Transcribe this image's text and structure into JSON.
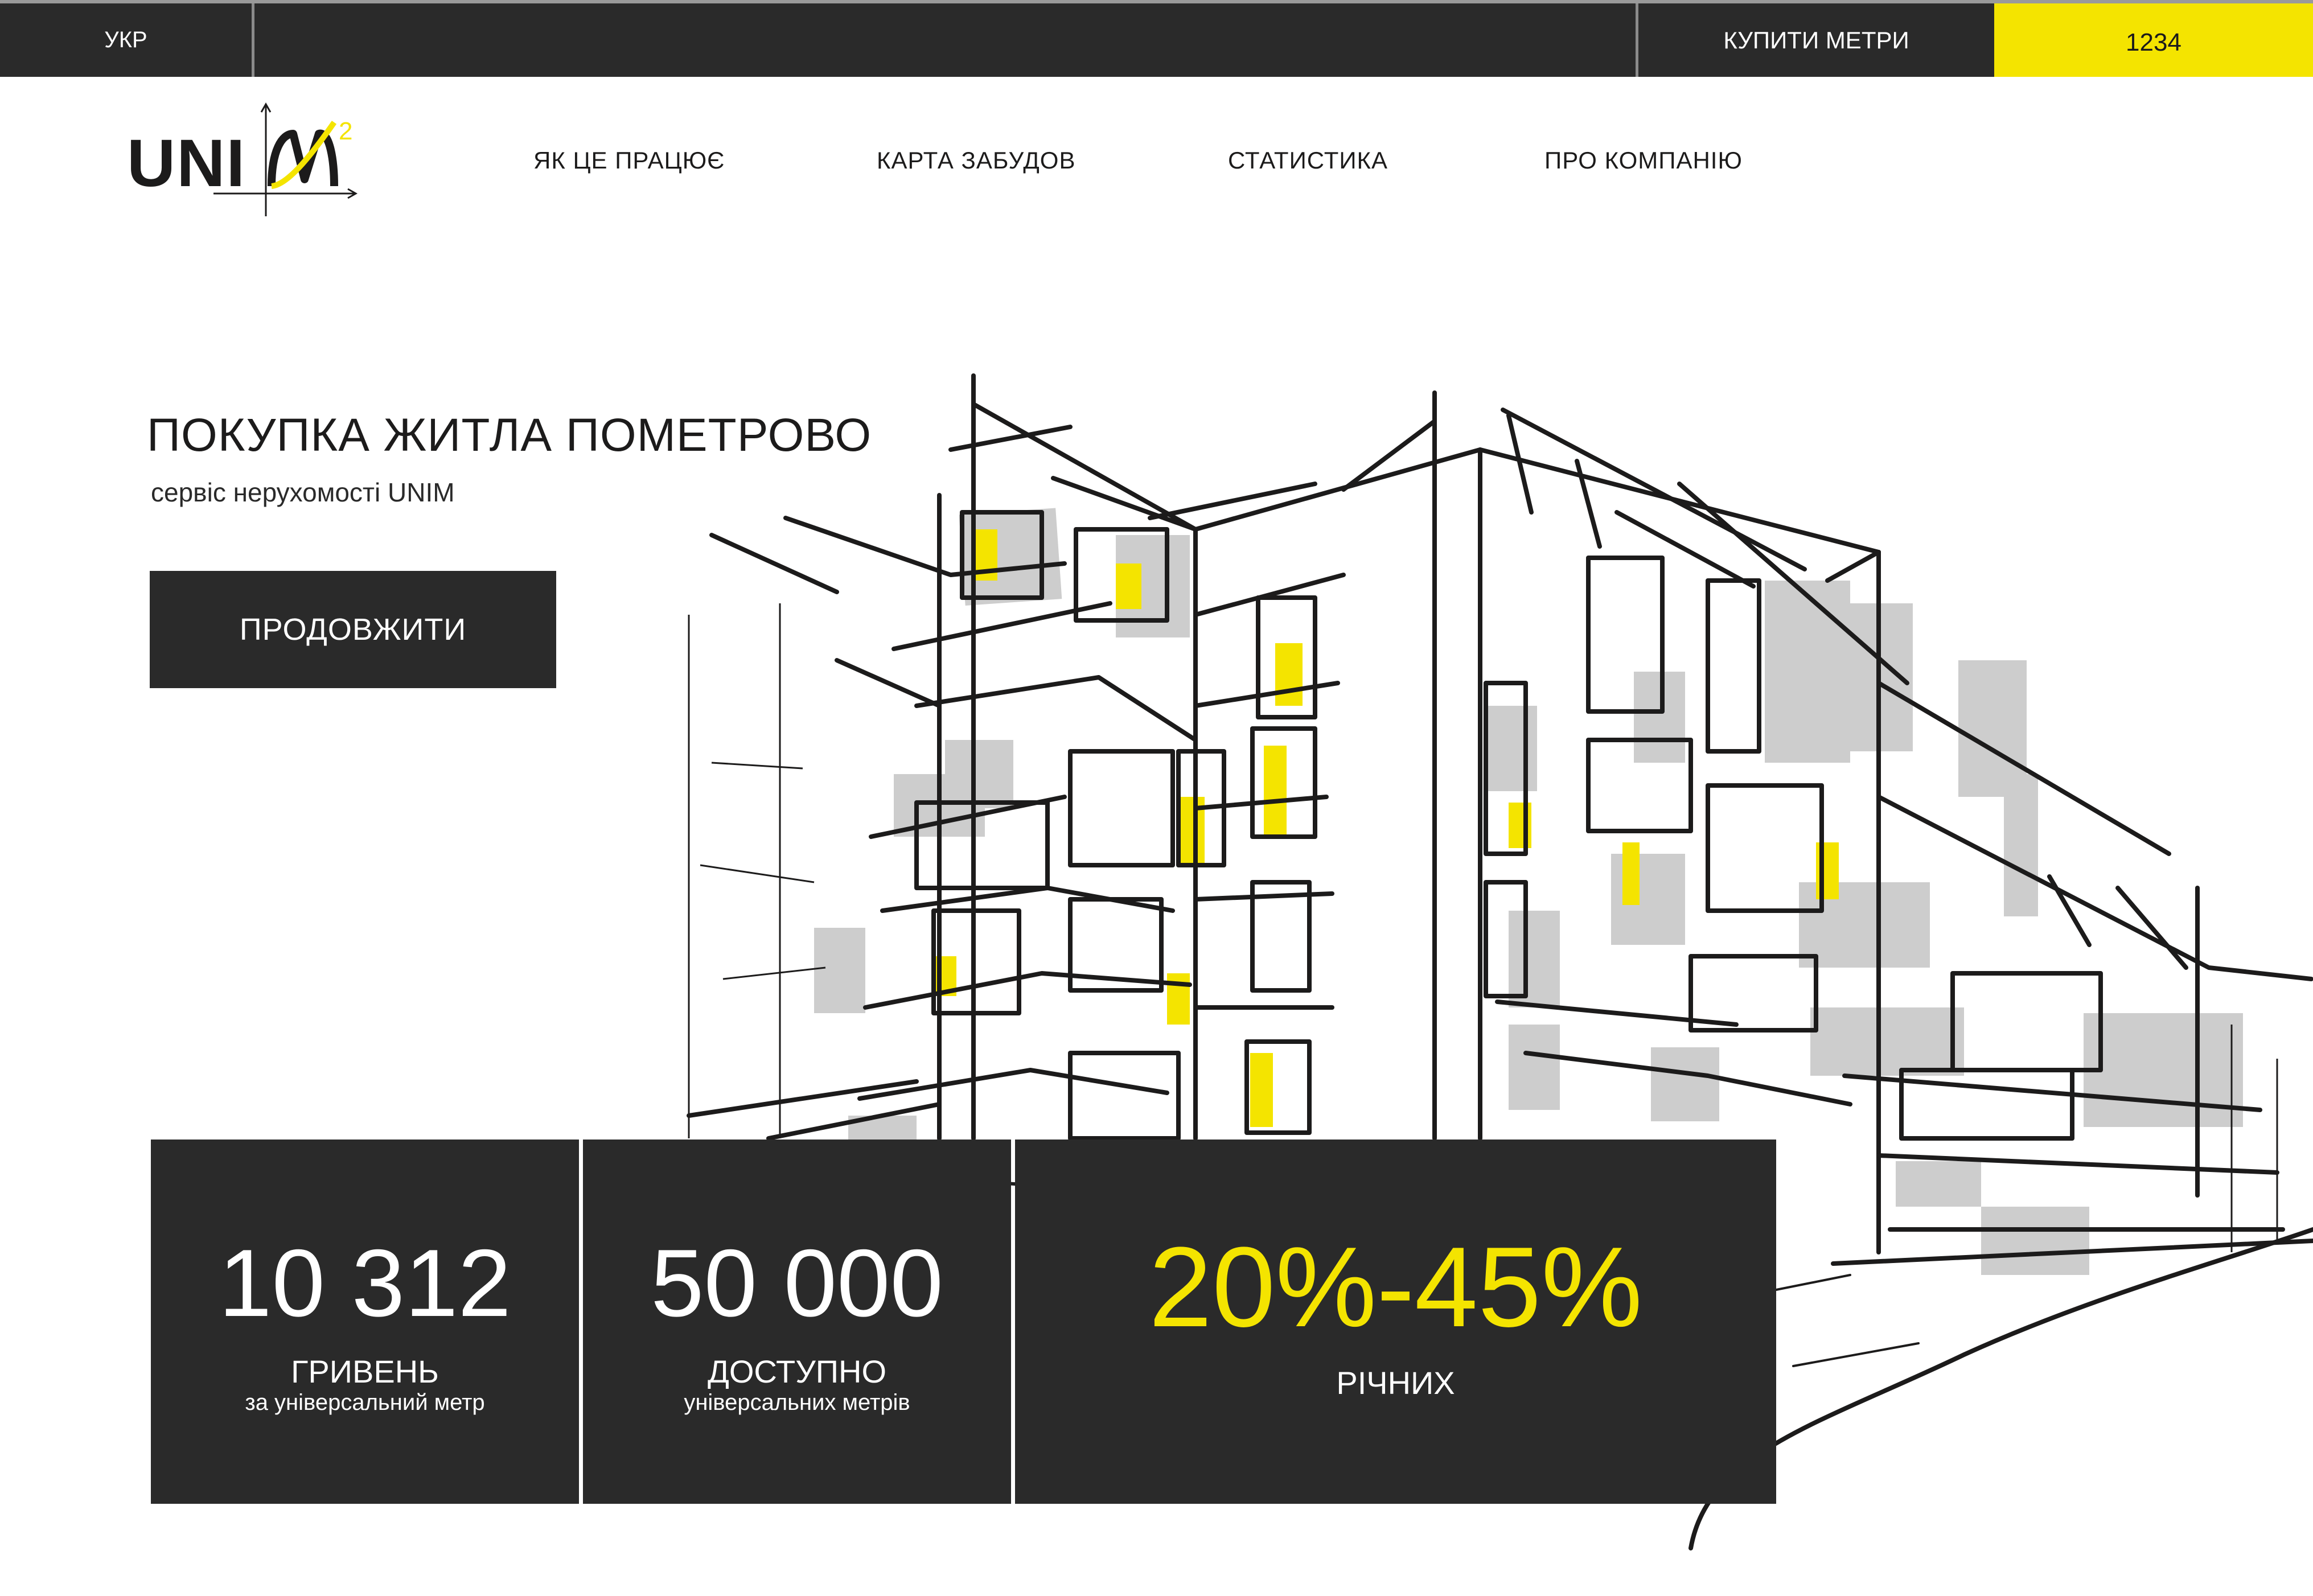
{
  "topbar": {
    "language": "УКР",
    "buy_label": "КУПИТИ МЕТРИ",
    "counter_value": "1234",
    "accent_color": "#f4e400",
    "bar_color": "#2a2a2a"
  },
  "logo": {
    "text": "UNIM",
    "superscript": "2"
  },
  "nav": {
    "items": [
      {
        "label": "ЯК ЦЕ ПРАЦЮЄ"
      },
      {
        "label": "КАРТА ЗАБУДОВ"
      },
      {
        "label": "СТАТИСТИКА"
      },
      {
        "label": "ПРО КОМПАНІЮ"
      }
    ]
  },
  "hero": {
    "title": "ПОКУПКА ЖИТЛА ПОМЕТРОВО",
    "subtitle": "сервіс нерухомості UNIM",
    "cta_label": "ПРОДОВЖИТИ",
    "illustration": "building-sketch"
  },
  "stats": [
    {
      "value": "10 312",
      "label": "ГРИВЕНЬ",
      "note": "за універсальний метр"
    },
    {
      "value": "50 000",
      "label": "ДОСТУПНО",
      "note": "універсальних метрів"
    },
    {
      "value": "20%-45%",
      "label": "РІЧНИХ",
      "note": ""
    }
  ]
}
